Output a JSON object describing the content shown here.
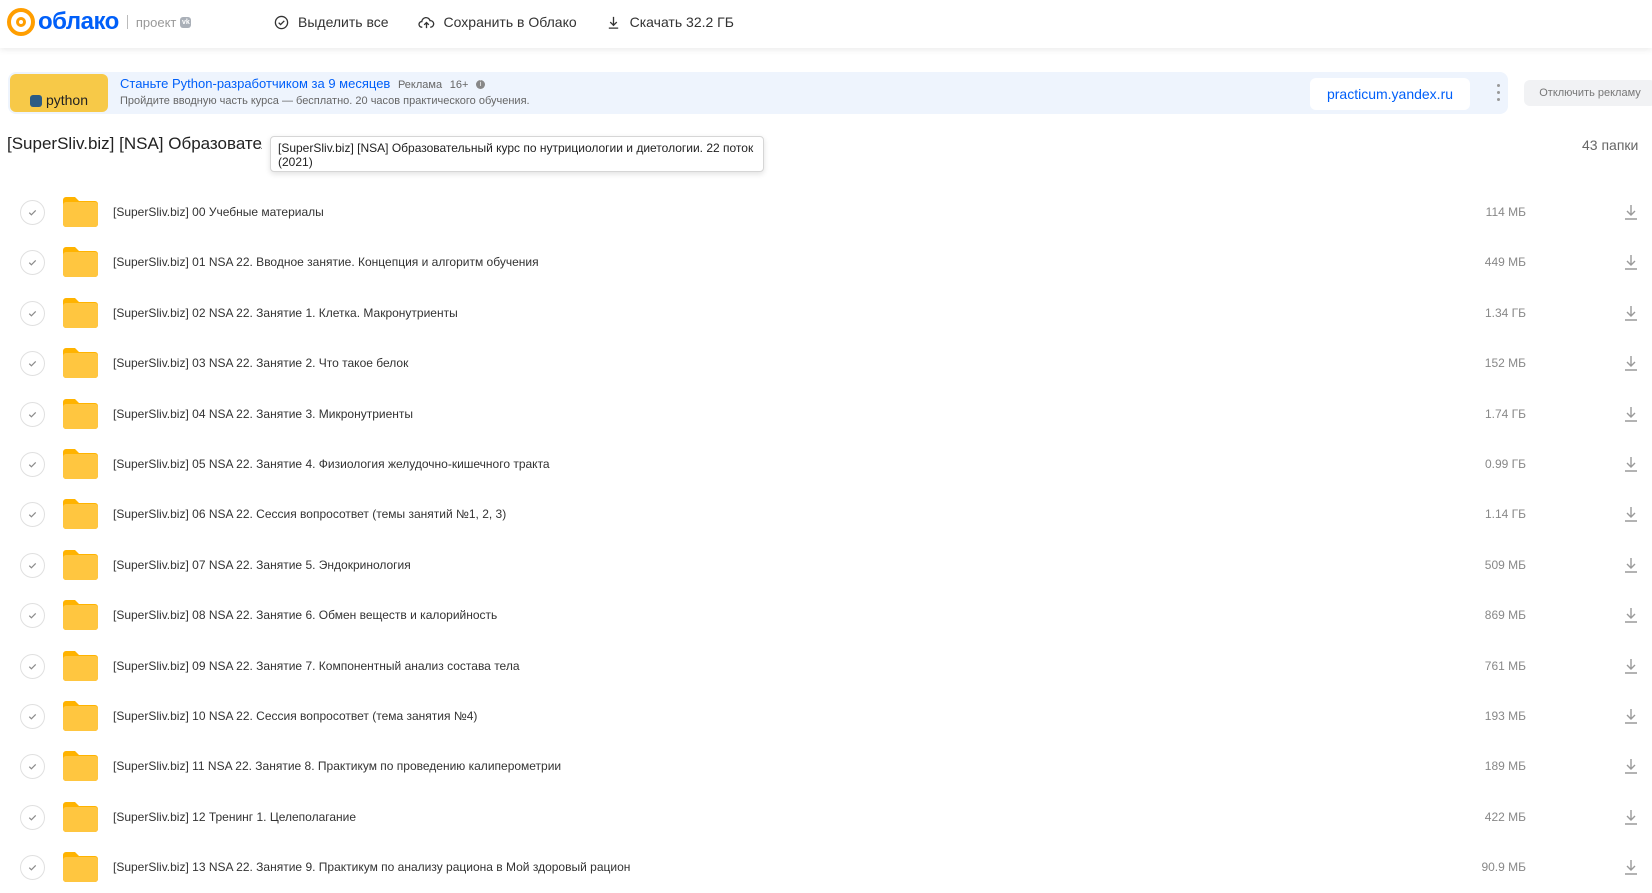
{
  "header": {
    "logo_text": "облако",
    "logo_sub": "проект",
    "logo_vk": "vk",
    "toolbar": [
      {
        "label": "Выделить все",
        "icon": "check-circle-icon"
      },
      {
        "label": "Сохранить в Облако",
        "icon": "cloud-upload-icon"
      },
      {
        "label": "Скачать 32.2 ГБ",
        "icon": "download-icon"
      }
    ]
  },
  "ad": {
    "thumb_text": "python",
    "title": "Станьте Python-разработчиком за 9 месяцев",
    "tag": "Реклама",
    "age": "16+",
    "description": "Пройдите вводную часть курса — бесплатно. 20 часов практического обучения.",
    "button": "practicum.yandex.ru",
    "disable": "Отключить рекламу"
  },
  "folder": {
    "title": "[SuperSliv.biz] [NSA] Образовательный курс по нутрициологии и диетологии. 22 поток (2021)",
    "tooltip": "[SuperSliv.biz] [NSA] Образовательный курс по нутрициологии и диетологии. 22 поток (2021)",
    "count": "43 папки"
  },
  "files": [
    {
      "name": "[SuperSliv.biz] 00 Учебные материалы",
      "size": "114 МБ"
    },
    {
      "name": "[SuperSliv.biz] 01 NSA 22. Вводное занятие. Концепция и алгоритм обучения",
      "size": "449 МБ"
    },
    {
      "name": "[SuperSliv.biz] 02 NSA 22. Занятие 1. Клетка. Макронутриенты",
      "size": "1.34 ГБ"
    },
    {
      "name": "[SuperSliv.biz] 03 NSA 22. Занятие 2. Что такое белок",
      "size": "152 МБ"
    },
    {
      "name": "[SuperSliv.biz] 04 NSA 22. Занятие 3. Микронутриенты",
      "size": "1.74 ГБ"
    },
    {
      "name": "[SuperSliv.biz] 05 NSA 22. Занятие 4. Физиология желудочно-кишечного тракта",
      "size": "0.99 ГБ"
    },
    {
      "name": "[SuperSliv.biz] 06 NSA 22. Сессия вопросответ (темы занятий №1, 2, 3)",
      "size": "1.14 ГБ"
    },
    {
      "name": "[SuperSliv.biz] 07 NSA 22. Занятие 5. Эндокринология",
      "size": "509 МБ"
    },
    {
      "name": "[SuperSliv.biz] 08 NSA 22. Занятие 6. Обмен веществ и калорийность",
      "size": "869 МБ"
    },
    {
      "name": "[SuperSliv.biz] 09 NSA 22. Занятие 7. Компонентный анализ состава тела",
      "size": "761 МБ"
    },
    {
      "name": "[SuperSliv.biz] 10 NSA 22. Сессия вопросответ (тема занятия №4)",
      "size": "193 МБ"
    },
    {
      "name": "[SuperSliv.biz] 11 NSA 22. Занятие 8. Практикум по проведению калиперометрии",
      "size": "189 МБ"
    },
    {
      "name": "[SuperSliv.biz] 12 Тренинг 1. Целеполагание",
      "size": "422 МБ"
    },
    {
      "name": "[SuperSliv.biz] 13 NSA 22. Занятие 9. Практикум по анализу рациона в Мой здоровый рацион",
      "size": "90.9 МБ"
    }
  ],
  "colors": {
    "brand_blue": "#005ff9",
    "brand_orange": "#ff9e00",
    "folder_yellow": "#ffc640"
  }
}
